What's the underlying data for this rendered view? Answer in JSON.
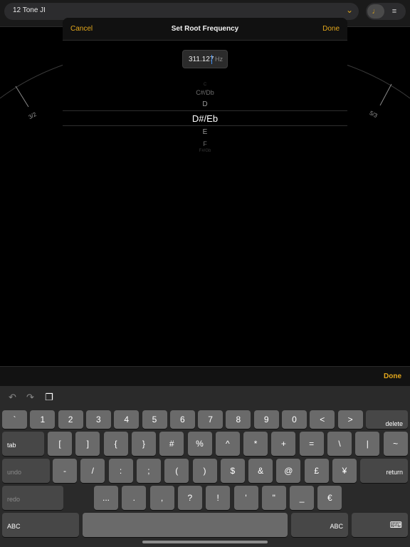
{
  "app": {
    "scale_name": "12 Tone JI",
    "ratio_left": "3/2",
    "ratio_right": "5/3"
  },
  "dialog": {
    "cancel_label": "Cancel",
    "title": "Set Root Frequency",
    "done_label": "Done",
    "frequency_value": "311.127",
    "frequency_unit": "Hz",
    "note_picker": {
      "items": [
        "C",
        "C#/Db",
        "D",
        "D#/Eb",
        "E",
        "F",
        "F#/Gb"
      ],
      "selected": "D#/Eb"
    }
  },
  "keyboard": {
    "accessory_done_label": "Done",
    "row1": [
      "`",
      "1",
      "2",
      "3",
      "4",
      "5",
      "6",
      "7",
      "8",
      "9",
      "0",
      "<",
      ">"
    ],
    "delete_label": "delete",
    "tab_label": "tab",
    "row2": [
      "[",
      "]",
      "{",
      "}",
      "#",
      "%",
      "^",
      "*",
      "+",
      "=",
      "\\",
      "|",
      "~"
    ],
    "undo_label": "undo",
    "row3": [
      "-",
      "/",
      ":",
      ";",
      "(",
      ")",
      "$",
      "&",
      "@",
      "£",
      "¥"
    ],
    "return_label": "return",
    "redo_label": "redo",
    "row4": [
      "...",
      ".",
      ",",
      "?",
      "!",
      "'",
      "\"",
      "_",
      "€"
    ],
    "abc_label": "ABC",
    "space_label": ""
  },
  "colors": {
    "accent": "#e3a71c",
    "key": "#6a6a6a",
    "function_key": "#474747",
    "keyboard_bg": "#2a2a2a"
  }
}
